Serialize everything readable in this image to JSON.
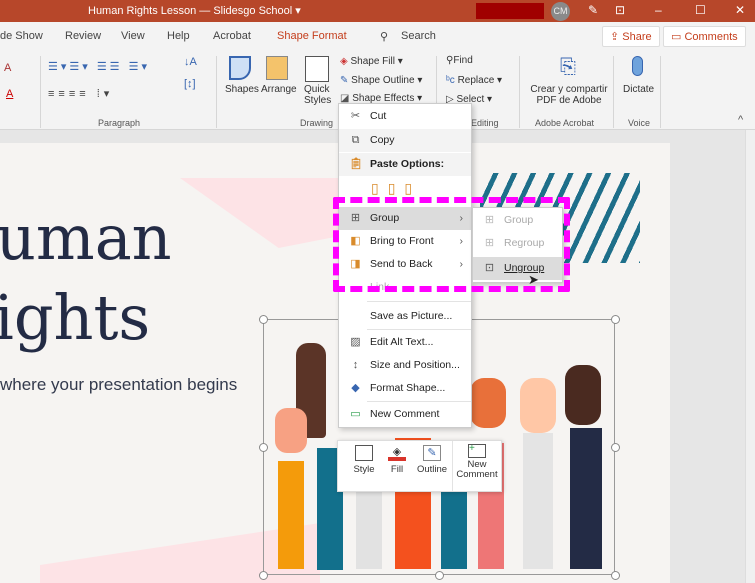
{
  "window": {
    "title": "Human Rights Lesson — Slidesgo School",
    "title_caret": "▾",
    "avatar": "CM",
    "minimize": "–",
    "maximize": "☐",
    "close": "✕"
  },
  "tabs": {
    "items": [
      "de Show",
      "Review",
      "View",
      "Help",
      "Acrobat",
      "Shape Format"
    ],
    "search": "Search",
    "share": "Share",
    "comments": "Comments"
  },
  "ribbon": {
    "paragraph_group": "Paragraph",
    "drawing_group": "Drawing",
    "editing_group": "Editing",
    "acrobat_group": "Adobe Acrobat",
    "voice_group": "Voice",
    "shapes": "Shapes",
    "arrange": "Arrange",
    "quick_styles_1": "Quick",
    "quick_styles_2": "Styles",
    "shape_fill": "Shape Fill",
    "shape_outline": "Shape Outline",
    "shape_effects": "Shape Effects",
    "find": "Find",
    "replace": "Replace",
    "select": "Select",
    "acrobat_1": "Crear y compartir",
    "acrobat_2": "PDF de Adobe",
    "dictate": "Dictate"
  },
  "slide": {
    "title_line1": "uman",
    "title_line2": "ights",
    "subtitle": "where your presentation begins"
  },
  "context_menu": {
    "cut": "Cut",
    "copy": "Copy",
    "paste_options": "Paste Options:",
    "group": "Group",
    "bring_to_front": "Bring to Front",
    "send_to_back": "Send to Back",
    "link": "Link",
    "save_as_picture": "Save as Picture...",
    "edit_alt_text": "Edit Alt Text...",
    "size_and_position": "Size and Position...",
    "format_shape": "Format Shape...",
    "new_comment": "New Comment"
  },
  "submenu": {
    "group": "Group",
    "regroup": "Regroup",
    "ungroup": "Ungroup"
  },
  "mini_toolbar": {
    "style": "Style",
    "fill": "Fill",
    "outline": "Outline",
    "new_comment_1": "New",
    "new_comment_2": "Comment"
  },
  "colors": {
    "accent": "#b7472a",
    "highlight": "#ff00ff",
    "navy": "#232b45"
  }
}
